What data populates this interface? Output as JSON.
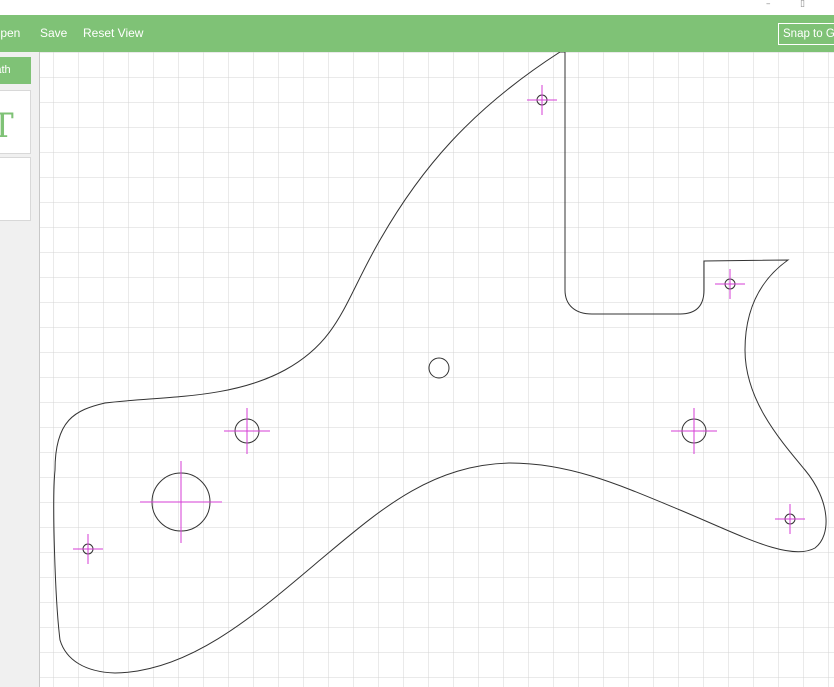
{
  "window": {
    "minimize_glyph": "–",
    "maximize_glyph": "▯"
  },
  "toolbar": {
    "open_label": "Open",
    "save_label": "Save",
    "reset_view_label": "Reset View",
    "snap_to_grid_label": "Snap to Grid"
  },
  "sidebar": {
    "active_label": "Path",
    "text_tool_glyph": "T"
  },
  "colors": {
    "accent": "#7fc276",
    "grid": "#d4d4d4",
    "outline": "#333333",
    "marker": "#d63cd6"
  },
  "icons": [
    "minimize-icon",
    "maximize-icon",
    "text-tool-icon"
  ]
}
